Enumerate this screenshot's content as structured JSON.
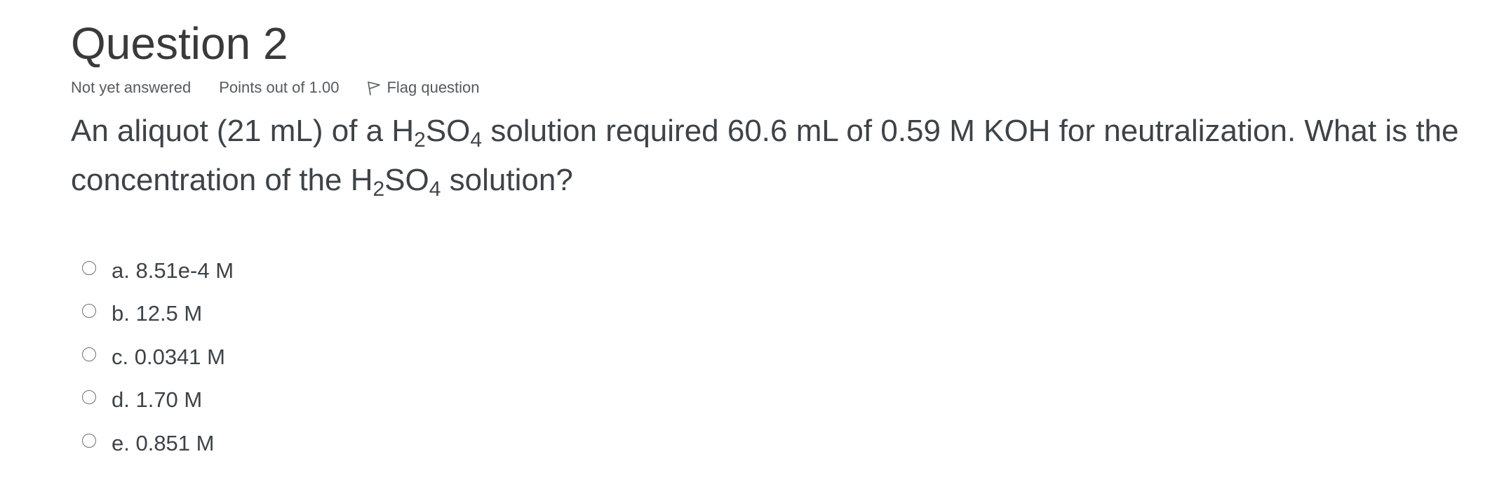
{
  "question": {
    "title": "Question 2",
    "state": "Not yet answered",
    "grade": "Points out of 1.00",
    "flag_label": "Flag question",
    "flag_icon": "flag-icon",
    "text": {
      "part1": "An aliquot (21 mL) of a H",
      "sub1": "2",
      "part2": "SO",
      "sub2": "4",
      "part3": " solution required 60.6 mL of 0.59 M KOH for neutralization. What is the concentration of the H",
      "sub3": "2",
      "part4": "SO",
      "sub4": "4",
      "part5": " solution?"
    },
    "answers": [
      {
        "label": "a. 8.51e-4 M",
        "selected": false
      },
      {
        "label": "b. 12.5 M",
        "selected": false
      },
      {
        "label": "c. 0.0341 M",
        "selected": false
      },
      {
        "label": "d. 1.70 M",
        "selected": false
      },
      {
        "label": "e. 0.851 M",
        "selected": false
      }
    ]
  }
}
